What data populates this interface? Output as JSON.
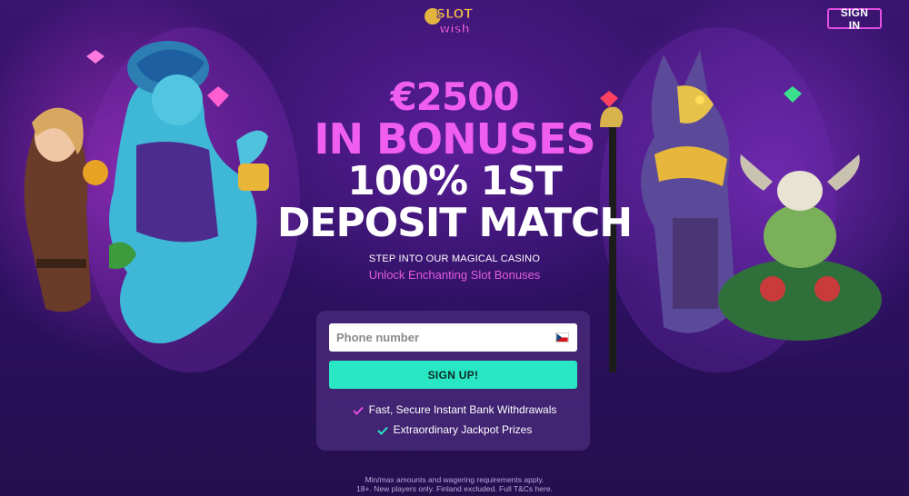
{
  "header": {
    "logo_text": "SLOT WISH",
    "signin_label": "SIGN IN"
  },
  "hero": {
    "amount": "€2500",
    "bonuses": "IN BONUSES",
    "match_line1": "100% 1ST",
    "match_line2": "DEPOSIT MATCH",
    "sub_heading": "STEP INTO OUR MAGICAL CASINO",
    "sub_tagline": "Unlock Enchanting Slot Bonuses"
  },
  "form": {
    "phone_placeholder": "Phone number",
    "country_flag_icon": "czech-flag-icon",
    "signup_label": "SIGN UP!"
  },
  "features": [
    "Fast, Secure Instant Bank Withdrawals",
    "Extraordinary Jackpot Prizes"
  ],
  "footer": {
    "line1": "Min/max amounts and wagering requirements apply.",
    "line2": "18+. New players only. Finland excluded. Full T&Cs here."
  },
  "colors": {
    "accent_pink": "#f05ef0",
    "accent_teal": "#29e6c4",
    "background": "#2a0f59"
  }
}
